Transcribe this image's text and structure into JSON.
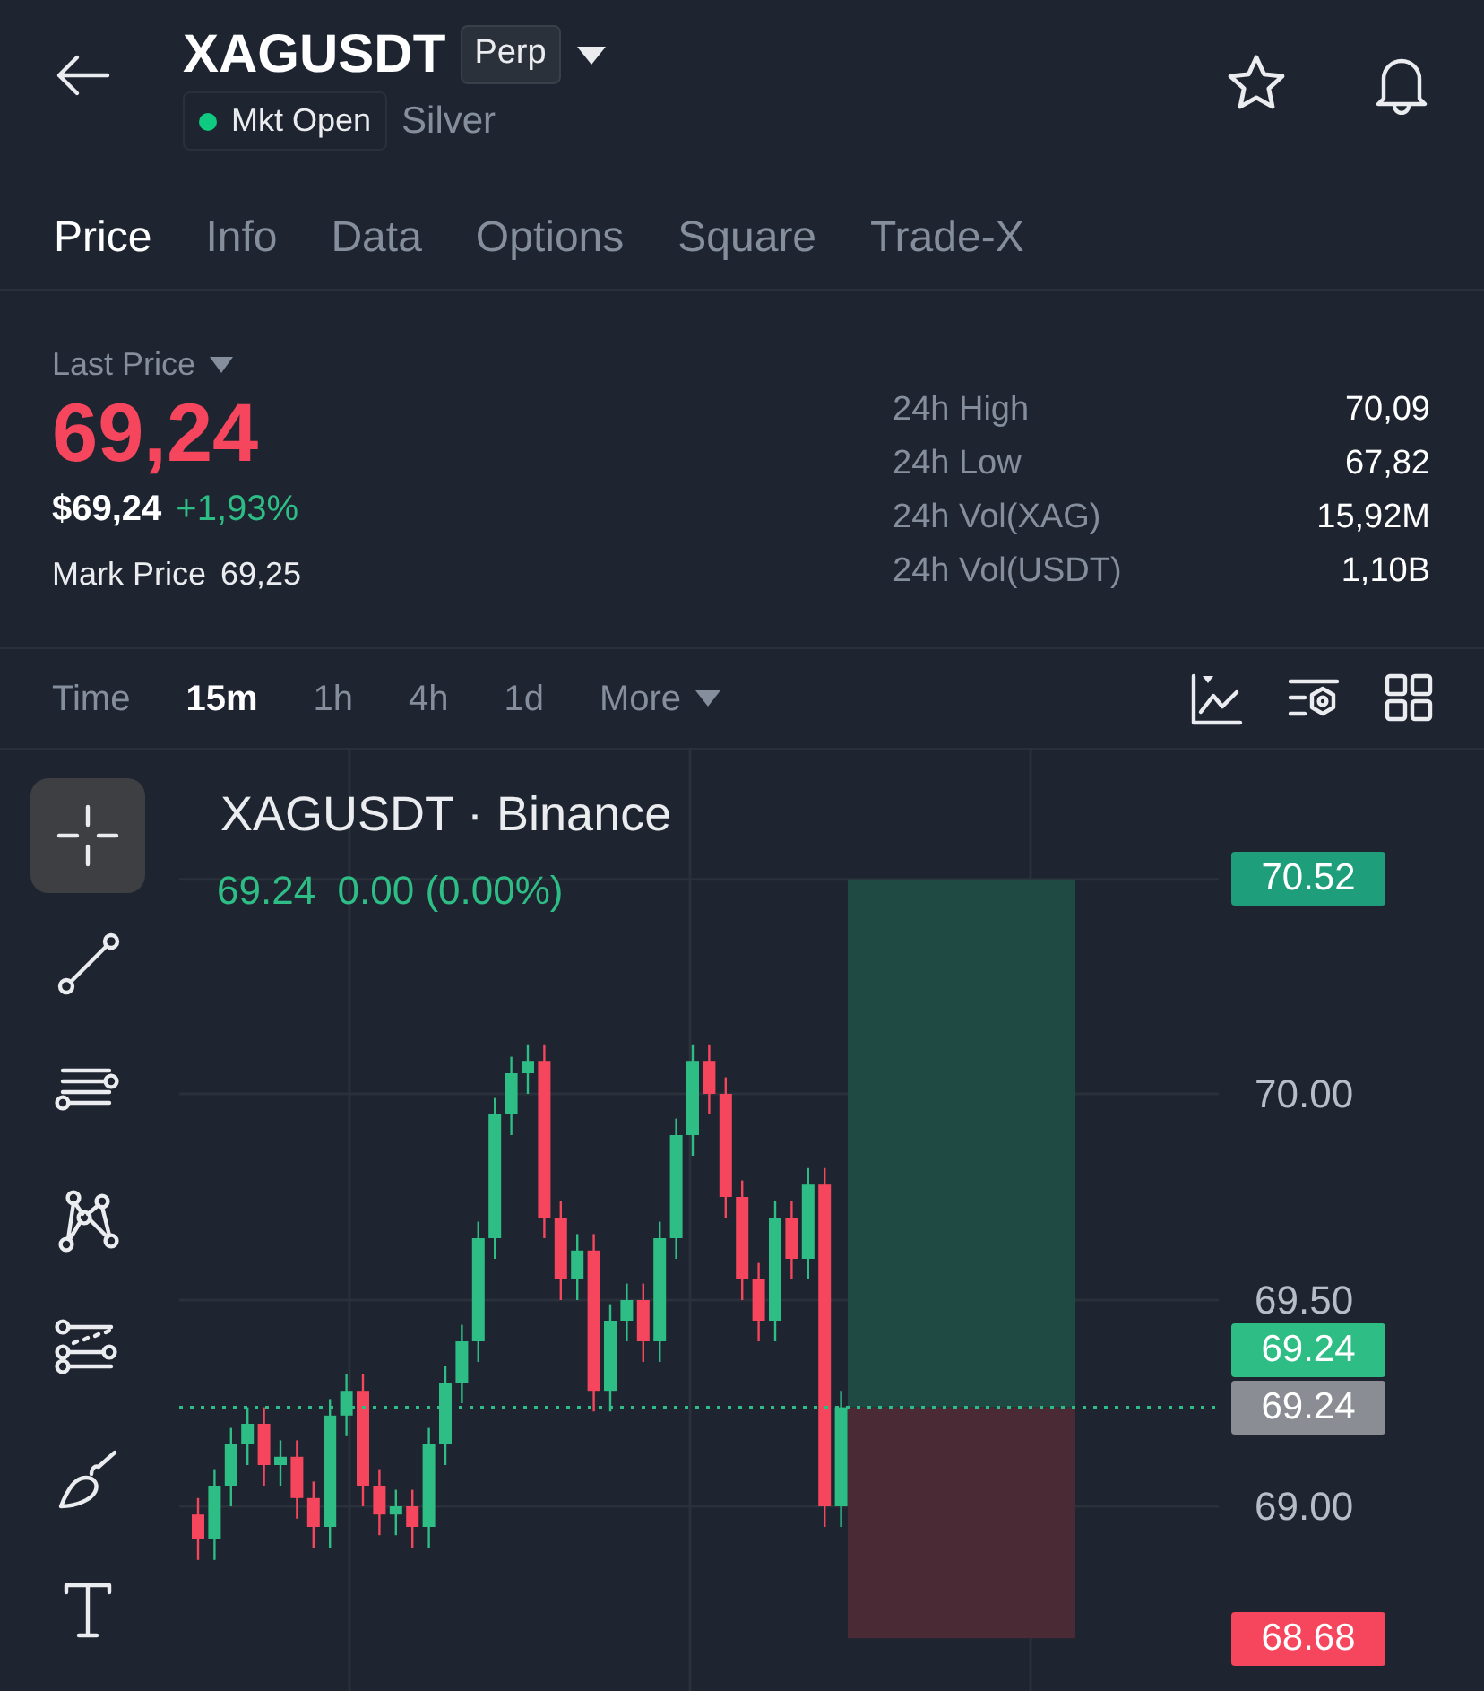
{
  "header": {
    "symbol": "XAGUSDT",
    "contract": "Perp",
    "market_status": "Mkt Open",
    "market_open": true,
    "name": "Silver",
    "favorite": false
  },
  "tabs": [
    {
      "label": "Price",
      "selected": true
    },
    {
      "label": "Info",
      "selected": false
    },
    {
      "label": "Data",
      "selected": false
    },
    {
      "label": "Options",
      "selected": false
    },
    {
      "label": "Square",
      "selected": false
    },
    {
      "label": "Trade-X",
      "selected": false
    }
  ],
  "ticker": {
    "last_price_label": "Last Price",
    "last_price": "69,24",
    "usd_price": "$69,24",
    "change": "+1,93%",
    "mark_price_label": "Mark Price",
    "mark_price": "69,25",
    "stats": [
      {
        "label": "24h High",
        "value": "70,09"
      },
      {
        "label": "24h Low",
        "value": "67,82"
      },
      {
        "label": "24h Vol(XAG)",
        "value": "15,92M"
      },
      {
        "label": "24h Vol(USDT)",
        "value": "1,10B"
      }
    ]
  },
  "intervals": [
    {
      "label": "Time",
      "selected": false
    },
    {
      "label": "15m",
      "selected": true
    },
    {
      "label": "1h",
      "selected": false
    },
    {
      "label": "4h",
      "selected": false
    },
    {
      "label": "1d",
      "selected": false
    },
    {
      "label": "More",
      "selected": false
    }
  ],
  "tools": [
    {
      "selected": true
    },
    {
      "selected": false
    },
    {
      "selected": false
    },
    {
      "selected": false
    },
    {
      "selected": false
    },
    {
      "selected": false
    },
    {
      "selected": false
    }
  ],
  "chart": {
    "title": "XAGUSDT · Binance",
    "ohlc": "69.24  0.00 (0.00%)",
    "axis_labels": [
      {
        "text": "70.00"
      },
      {
        "text": "69.50"
      },
      {
        "text": "69.00"
      }
    ],
    "price_tags": [
      {
        "text": "70.52",
        "color": "#1f9e7c"
      },
      {
        "text": "69.24",
        "color": "#2ebd85"
      },
      {
        "text": "69.24",
        "color": "#8a8d93"
      },
      {
        "text": "68.68",
        "color": "#f6465d"
      }
    ]
  }
}
